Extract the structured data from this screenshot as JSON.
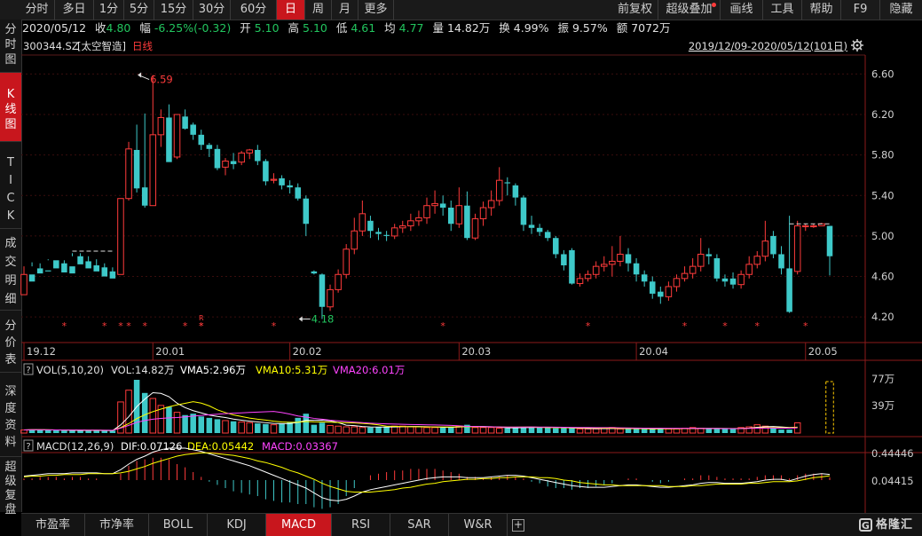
{
  "periods": [
    "分时",
    "多日",
    "1分",
    "5分",
    "15分",
    "30分",
    "60分",
    "日",
    "周",
    "月",
    "更多"
  ],
  "active_period": "日",
  "tools": [
    "前复权",
    "超级叠加",
    "画线",
    "工具",
    "帮助",
    "F9",
    "隐藏"
  ],
  "left_tabs": [
    "分时图",
    "K线图",
    "TICK",
    "成交明细",
    "分价表",
    "深度资料",
    "超级复盘"
  ],
  "active_left_tab": "K线图",
  "info": {
    "date": "2020/05/12",
    "close_label": "收",
    "close": "4.80",
    "change_label": "幅",
    "change": "-6.25%(-0.32)",
    "open_label": "开",
    "open": "5.10",
    "high_label": "高",
    "high": "5.10",
    "low_label": "低",
    "low": "4.61",
    "avg_label": "均",
    "avg": "4.77",
    "vol_label": "量",
    "vol": "14.82万",
    "turnover_label": "换",
    "turnover": "4.99%",
    "amplitude_label": "振",
    "amplitude": "9.57%",
    "amount_label": "额",
    "amount": "7072万"
  },
  "stock": {
    "code": "300344.SZ",
    "name": "[太空智造]",
    "line_type": "日线"
  },
  "range_text": "2019/12/09-2020/05/12(101日)",
  "bottom_tabs": [
    "市盈率",
    "市净率",
    "BOLL",
    "KDJ",
    "MACD",
    "RSI",
    "SAR",
    "W&R"
  ],
  "active_bottom_tab": "MACD",
  "vol_panel": {
    "title": "VOL(5,10,20)",
    "vol": "VOL:14.82万",
    "vma5": "VMA5:2.96万",
    "vma10": "VMA10:5.31万",
    "vma20": "VMA20:6.01万",
    "axis_top": "77万",
    "axis_mid": "39万"
  },
  "macd_panel": {
    "title": "MACD(12,26,9)",
    "dif": "DIF:0.07126",
    "dea": "DEA:0.05442",
    "macd": "MACD:0.03367",
    "axis_top": "0.44446",
    "axis_mid": "0.04415"
  },
  "colors": {
    "up": "#ff3b3b",
    "down": "#3ec9c9",
    "ma_white": "#ffffff",
    "ma_yellow": "#ffff00",
    "ma_magenta": "#ff44ff",
    "active": "#c8161d"
  },
  "chart_data": {
    "type": "candlestick",
    "title": "300344.SZ [太空智造] 日线",
    "ylim": [
      4.0,
      6.7
    ],
    "yticks": [
      6.6,
      6.2,
      5.8,
      5.4,
      5.0,
      4.6,
      4.2
    ],
    "x_labels": [
      {
        "index": 0,
        "label": "19.12"
      },
      {
        "index": 16,
        "label": "20.01"
      },
      {
        "index": 33,
        "label": "20.02"
      },
      {
        "index": 54,
        "label": "20.03"
      },
      {
        "index": 76,
        "label": "20.04"
      },
      {
        "index": 97,
        "label": "20.05"
      }
    ],
    "annotations": [
      {
        "index": 14,
        "value": 6.59,
        "label": "6.59"
      },
      {
        "index": 34,
        "value": 4.18,
        "label": "4.18"
      }
    ],
    "candles": [
      [
        4.42,
        4.62,
        4.55,
        4.7
      ],
      [
        4.62,
        4.55,
        4.7,
        4.74
      ],
      [
        4.68,
        4.63,
        4.73,
        4.65
      ],
      [
        4.66,
        4.65,
        4.77,
        4.76
      ],
      [
        4.76,
        4.68,
        4.74,
        4.72
      ],
      [
        4.73,
        4.64,
        4.76,
        4.7
      ],
      [
        4.7,
        4.63,
        4.83,
        4.8
      ],
      [
        4.8,
        4.72,
        4.83,
        4.75
      ],
      [
        4.75,
        4.68,
        4.8,
        4.71
      ],
      [
        4.71,
        4.65,
        4.77,
        4.69
      ],
      [
        4.69,
        4.6,
        4.73,
        4.65
      ],
      [
        4.65,
        4.58,
        4.69,
        4.62
      ],
      [
        4.62,
        5.37,
        5.36,
        5.37
      ],
      [
        5.37,
        5.86,
        5.35,
        5.93
      ],
      [
        5.85,
        5.47,
        5.43,
        6.1
      ],
      [
        5.48,
        5.3,
        5.28,
        6.21
      ],
      [
        5.3,
        6.0,
        5.95,
        6.59
      ],
      [
        6.0,
        6.17,
        5.88,
        6.25
      ],
      [
        6.17,
        5.73,
        5.75,
        6.3
      ],
      [
        5.78,
        6.2,
        5.76,
        6.2
      ],
      [
        6.18,
        6.06,
        6.05,
        6.25
      ],
      [
        6.1,
        6.0,
        5.95,
        6.12
      ],
      [
        6.0,
        5.9,
        5.85,
        6.05
      ],
      [
        5.9,
        5.86,
        5.78,
        5.92
      ],
      [
        5.86,
        5.67,
        5.65,
        5.9
      ],
      [
        5.68,
        5.74,
        5.6,
        5.77
      ],
      [
        5.74,
        5.71,
        5.66,
        5.82
      ],
      [
        5.73,
        5.82,
        5.7,
        5.84
      ],
      [
        5.82,
        5.85,
        5.76,
        5.86
      ],
      [
        5.85,
        5.74,
        5.7,
        5.9
      ],
      [
        5.74,
        5.54,
        5.5,
        5.76
      ],
      [
        5.55,
        5.56,
        5.52,
        5.62
      ],
      [
        5.57,
        5.5,
        5.46,
        5.6
      ],
      [
        5.5,
        5.48,
        5.42,
        5.55
      ],
      [
        5.48,
        5.37,
        5.35,
        5.52
      ],
      [
        5.37,
        5.12,
        5.0,
        5.4
      ],
      [
        4.65,
        4.63,
        4.62,
        4.66
      ],
      [
        4.62,
        4.3,
        4.18,
        4.63
      ],
      [
        4.3,
        4.47,
        4.26,
        4.52
      ],
      [
        4.47,
        4.62,
        4.44,
        4.67
      ],
      [
        4.62,
        4.87,
        4.58,
        4.92
      ],
      [
        4.87,
        5.05,
        4.82,
        5.18
      ],
      [
        5.05,
        5.22,
        5.0,
        5.35
      ],
      [
        5.15,
        5.05,
        4.98,
        5.2
      ],
      [
        5.04,
        5.02,
        4.96,
        5.08
      ],
      [
        5.01,
        5.0,
        4.95,
        5.05
      ],
      [
        5.0,
        5.08,
        4.97,
        5.12
      ],
      [
        5.08,
        5.1,
        5.03,
        5.15
      ],
      [
        5.1,
        5.15,
        5.05,
        5.22
      ],
      [
        5.15,
        5.18,
        5.1,
        5.25
      ],
      [
        5.18,
        5.3,
        5.12,
        5.38
      ],
      [
        5.3,
        5.32,
        5.22,
        5.45
      ],
      [
        5.32,
        5.28,
        5.2,
        5.4
      ],
      [
        5.28,
        5.12,
        5.05,
        5.35
      ],
      [
        5.12,
        5.3,
        5.08,
        5.48
      ],
      [
        5.3,
        4.98,
        4.96,
        5.44
      ],
      [
        4.98,
        5.17,
        4.96,
        5.22
      ],
      [
        5.17,
        5.28,
        5.1,
        5.34
      ],
      [
        5.28,
        5.35,
        5.2,
        5.45
      ],
      [
        5.35,
        5.55,
        5.3,
        5.68
      ],
      [
        5.53,
        5.52,
        5.4,
        5.58
      ],
      [
        5.5,
        5.38,
        5.3,
        5.52
      ],
      [
        5.38,
        5.11,
        5.05,
        5.4
      ],
      [
        5.11,
        5.08,
        5.02,
        5.2
      ],
      [
        5.08,
        5.04,
        5.0,
        5.12
      ],
      [
        5.04,
        4.98,
        4.95,
        5.06
      ],
      [
        4.98,
        4.82,
        4.78,
        5.0
      ],
      [
        4.82,
        4.71,
        4.66,
        4.86
      ],
      [
        4.86,
        4.53,
        4.52,
        4.88
      ],
      [
        4.53,
        4.58,
        4.5,
        4.63
      ],
      [
        4.58,
        4.62,
        4.55,
        4.66
      ],
      [
        4.62,
        4.7,
        4.58,
        4.75
      ],
      [
        4.7,
        4.72,
        4.65,
        4.8
      ],
      [
        4.72,
        4.75,
        4.6,
        4.9
      ],
      [
        4.75,
        4.82,
        4.7,
        5.0
      ],
      [
        4.82,
        4.73,
        4.65,
        4.88
      ],
      [
        4.73,
        4.62,
        4.55,
        4.78
      ],
      [
        4.62,
        4.55,
        4.5,
        4.66
      ],
      [
        4.55,
        4.43,
        4.38,
        4.6
      ],
      [
        4.45,
        4.4,
        4.33,
        4.5
      ],
      [
        4.4,
        4.5,
        4.36,
        4.55
      ],
      [
        4.5,
        4.58,
        4.45,
        4.62
      ],
      [
        4.58,
        4.63,
        4.55,
        4.7
      ],
      [
        4.63,
        4.7,
        4.58,
        4.78
      ],
      [
        4.7,
        4.82,
        4.65,
        4.98
      ],
      [
        4.82,
        4.8,
        4.72,
        4.88
      ],
      [
        4.78,
        4.58,
        4.55,
        4.82
      ],
      [
        4.58,
        4.55,
        4.5,
        4.62
      ],
      [
        4.58,
        4.52,
        4.48,
        4.64
      ],
      [
        4.52,
        4.62,
        4.48,
        4.66
      ],
      [
        4.62,
        4.72,
        4.58,
        4.8
      ],
      [
        4.72,
        4.8,
        4.68,
        4.85
      ],
      [
        4.8,
        4.95,
        4.75,
        5.15
      ],
      [
        5.0,
        4.82,
        4.78,
        5.05
      ],
      [
        4.82,
        4.68,
        4.62,
        4.9
      ],
      [
        4.68,
        4.25,
        4.24,
        5.2
      ],
      [
        4.65,
        5.1,
        4.62,
        5.15
      ],
      [
        5.1,
        5.1,
        5.05,
        5.12
      ],
      [
        5.1,
        5.1,
        5.08,
        5.12
      ],
      [
        5.1,
        5.12,
        5.1,
        5.13
      ],
      [
        5.1,
        4.8,
        4.61,
        5.1
      ]
    ],
    "volume": [
      4.5,
      5.2,
      4.8,
      4.1,
      3.8,
      3.6,
      4.2,
      3.9,
      3.5,
      3.7,
      3.2,
      3.6,
      45,
      62,
      77,
      58,
      50,
      40,
      38,
      30,
      26,
      28,
      24,
      22,
      20,
      18,
      17,
      16,
      15,
      14,
      13,
      12,
      14,
      16,
      22,
      28,
      12,
      15,
      11,
      10,
      9,
      9,
      8,
      8,
      9,
      9,
      10,
      10,
      9,
      9,
      8,
      8,
      8,
      9,
      10,
      12,
      8,
      8,
      8,
      7,
      7,
      8,
      9,
      9,
      8,
      8,
      7,
      7,
      7,
      6,
      6,
      6,
      7,
      8,
      6,
      6,
      6,
      6,
      6,
      7,
      6,
      6,
      7,
      8,
      7,
      6,
      6,
      6,
      7,
      8,
      9,
      12,
      10,
      8,
      5,
      5,
      14.82
    ],
    "macd": {
      "dif": [
        0.05,
        0.06,
        0.07,
        0.08,
        0.08,
        0.08,
        0.09,
        0.09,
        0.09,
        0.09,
        0.08,
        0.08,
        0.13,
        0.2,
        0.26,
        0.3,
        0.35,
        0.38,
        0.4,
        0.4,
        0.4,
        0.38,
        0.36,
        0.33,
        0.3,
        0.27,
        0.24,
        0.21,
        0.18,
        0.14,
        0.1,
        0.06,
        0.02,
        -0.02,
        -0.06,
        -0.1,
        -0.16,
        -0.22,
        -0.25,
        -0.26,
        -0.24,
        -0.2,
        -0.15,
        -0.12,
        -0.1,
        -0.08,
        -0.06,
        -0.04,
        -0.02,
        0.0,
        0.02,
        0.03,
        0.04,
        0.04,
        0.04,
        0.03,
        0.03,
        0.03,
        0.04,
        0.05,
        0.06,
        0.06,
        0.05,
        0.03,
        0.01,
        -0.01,
        -0.03,
        -0.05,
        -0.07,
        -0.08,
        -0.09,
        -0.09,
        -0.09,
        -0.08,
        -0.07,
        -0.06,
        -0.06,
        -0.07,
        -0.08,
        -0.09,
        -0.09,
        -0.08,
        -0.07,
        -0.06,
        -0.04,
        -0.03,
        -0.03,
        -0.04,
        -0.04,
        -0.04,
        -0.03,
        -0.02,
        0.0,
        0.01,
        0.01,
        -0.01,
        0.02,
        0.05,
        0.07,
        0.08,
        0.07126
      ],
      "dea": [
        0.04,
        0.05,
        0.05,
        0.06,
        0.06,
        0.07,
        0.07,
        0.07,
        0.08,
        0.08,
        0.08,
        0.08,
        0.09,
        0.11,
        0.14,
        0.17,
        0.21,
        0.24,
        0.27,
        0.3,
        0.32,
        0.33,
        0.34,
        0.34,
        0.33,
        0.32,
        0.31,
        0.29,
        0.27,
        0.24,
        0.22,
        0.19,
        0.16,
        0.12,
        0.09,
        0.05,
        0.01,
        -0.04,
        -0.08,
        -0.11,
        -0.14,
        -0.15,
        -0.15,
        -0.15,
        -0.14,
        -0.13,
        -0.12,
        -0.1,
        -0.09,
        -0.07,
        -0.05,
        -0.04,
        -0.02,
        -0.01,
        0.0,
        0.01,
        0.01,
        0.02,
        0.02,
        0.03,
        0.03,
        0.04,
        0.04,
        0.04,
        0.03,
        0.03,
        0.02,
        0.0,
        -0.01,
        -0.03,
        -0.04,
        -0.05,
        -0.06,
        -0.06,
        -0.07,
        -0.07,
        -0.07,
        -0.07,
        -0.07,
        -0.07,
        -0.08,
        -0.08,
        -0.08,
        -0.07,
        -0.07,
        -0.06,
        -0.05,
        -0.05,
        -0.05,
        -0.05,
        -0.04,
        -0.04,
        -0.03,
        -0.02,
        -0.02,
        -0.02,
        -0.01,
        0.01,
        0.03,
        0.04,
        0.05442
      ]
    },
    "star_indices": [
      6,
      13,
      15,
      17,
      19,
      26,
      28,
      29,
      40,
      67,
      91,
      107,
      113,
      118,
      126
    ],
    "r_mark_index": 29,
    "prev_close_ref": [
      {
        "from": 6,
        "to": 11,
        "value": 4.85
      },
      {
        "from": 95,
        "to": 100,
        "value": 5.12
      }
    ]
  }
}
